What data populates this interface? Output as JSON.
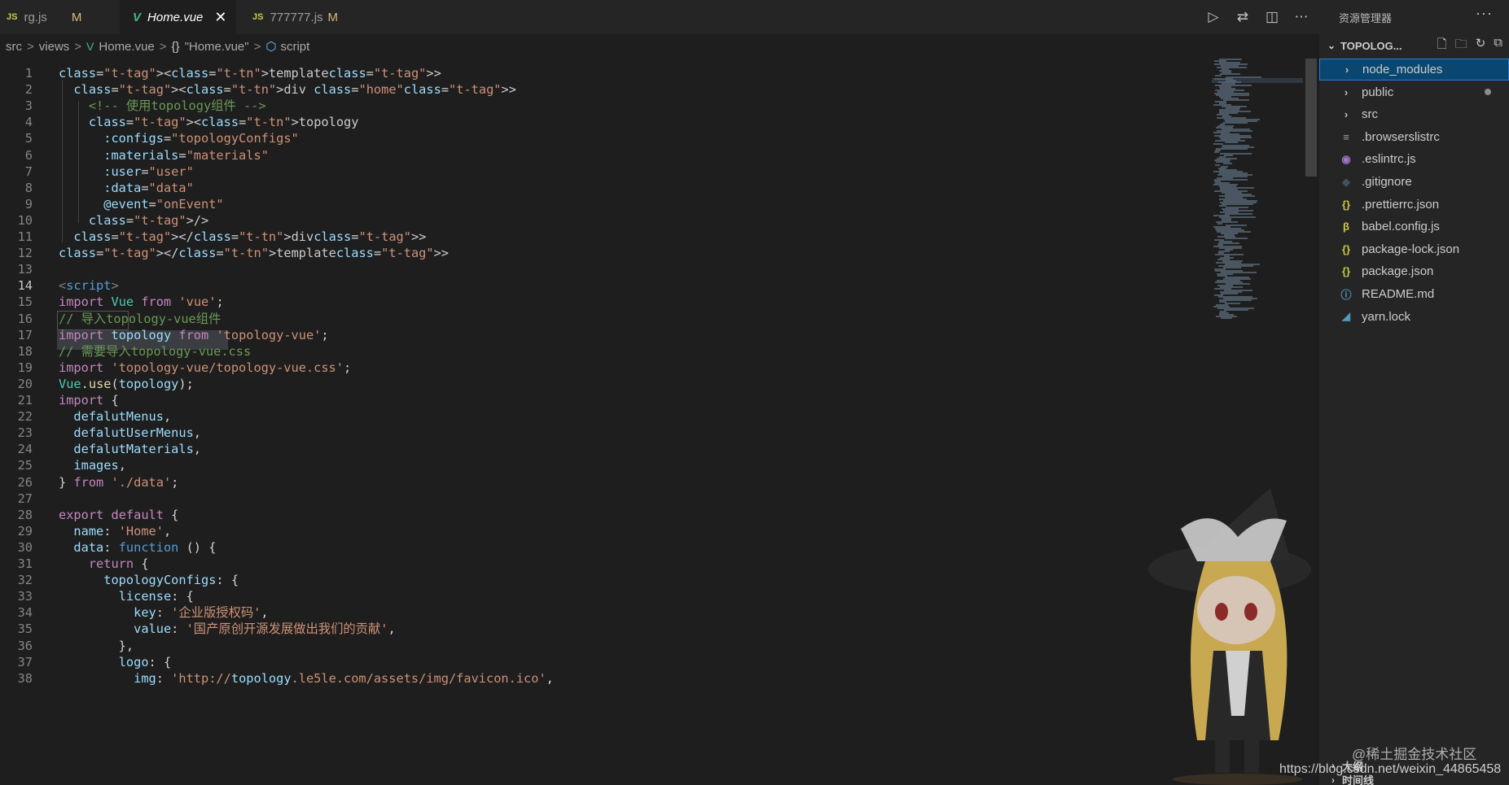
{
  "tabs": [
    {
      "file_type": "JS",
      "label": "rg.js",
      "status": "M"
    },
    {
      "file_type": "V",
      "label": "Home.vue",
      "close": "✕"
    },
    {
      "file_type": "JS",
      "label": "777777.js",
      "status": "M"
    }
  ],
  "breadcrumb": {
    "items": [
      "src",
      "views",
      "Home.vue",
      "\"Home.vue\"",
      "script"
    ],
    "separator": ">",
    "brace": "{}"
  },
  "explorer": {
    "title": "资源管理器",
    "section": "TOPOLOG...",
    "more": "···",
    "items": [
      {
        "icon": "›",
        "label": "node_modules"
      },
      {
        "icon": "›",
        "label": "public"
      },
      {
        "icon": "›",
        "label": "src"
      },
      {
        "icon": "≡",
        "label": ".browserslistrc"
      },
      {
        "icon": "◉",
        "label": ".eslintrc.js"
      },
      {
        "icon": "◆",
        "label": ".gitignore"
      },
      {
        "icon": "{}",
        "label": ".prettierrc.json"
      },
      {
        "icon": "β",
        "label": "babel.config.js"
      },
      {
        "icon": "{}",
        "label": "package-lock.json"
      },
      {
        "icon": "{}",
        "label": "package.json"
      },
      {
        "icon": "ⓘ",
        "label": "README.md"
      },
      {
        "icon": "◢",
        "label": "yarn.lock"
      }
    ],
    "footer_1": "大纲",
    "footer_2": "时间线"
  },
  "watermark": {
    "line1": "@稀土掘金技术社区",
    "line2": "https://blog.csdn.net/weixin_44865458"
  },
  "code_lines": [
    "<template>",
    "  <div class=\"home\">",
    "    <!-- 使用topology组件 -->",
    "    <topology",
    "      :configs=\"topologyConfigs\"",
    "      :materials=\"materials\"",
    "      :user=\"user\"",
    "      :data=\"data\"",
    "      @event=\"onEvent\"",
    "    />",
    "  </div>",
    "</template>",
    "",
    "<script>",
    "import Vue from 'vue';",
    "// 导入topology-vue组件",
    "import topology from 'topology-vue';",
    "// 需要导入topology-vue.css",
    "import 'topology-vue/topology-vue.css';",
    "Vue.use(topology);",
    "import {",
    "  defalutMenus,",
    "  defalutUserMenus,",
    "  defalutMaterials,",
    "  images,",
    "} from './data';",
    "",
    "export default {",
    "  name: 'Home',",
    "  data: function () {",
    "    return {",
    "      topologyConfigs: {",
    "        license: {",
    "          key: '企业版授权码',",
    "          value: '国产原创开源发展做出我们的贡献',",
    "        },",
    "        logo: {",
    "          img: 'http://topology.le5le.com/assets/img/favicon.ico',"
  ],
  "current_line": 14
}
